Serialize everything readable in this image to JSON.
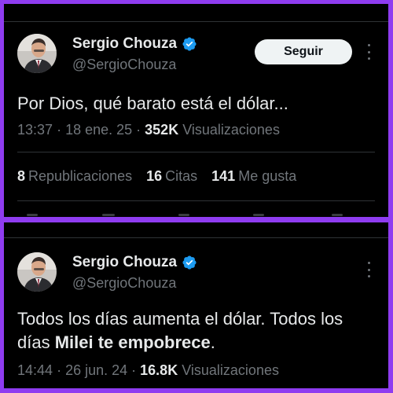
{
  "tweet1": {
    "display_name": "Sergio Chouza",
    "handle": "@SergioChouza",
    "follow_label": "Seguir",
    "text": "Por Dios, qué barato está el dólar...",
    "time": "13:37",
    "date": "18 ene. 25",
    "views_count": "352K",
    "views_label": "Visualizaciones",
    "stats": {
      "reposts_count": "8",
      "reposts_label": "Republicaciones",
      "quotes_count": "16",
      "quotes_label": "Citas",
      "likes_count": "141",
      "likes_label": "Me gusta"
    }
  },
  "tweet2": {
    "display_name": "Sergio Chouza",
    "handle": "@SergioChouza",
    "text_part1": "Todos los días aumenta el dólar. Todos los días ",
    "text_bold": "Milei te empobrece",
    "text_part2": ".",
    "time": "14:44",
    "date": "26 jun. 24",
    "views_count": "16.8K",
    "views_label": "Visualizaciones"
  },
  "colors": {
    "frame_border": "#8f3cf0",
    "background": "#000000",
    "verified_badge": "#1d9bf0",
    "primary_text": "#e7e9ea",
    "secondary_text": "#71767b"
  },
  "icons": {
    "verified": "verified-badge-icon",
    "more": "more-options-icon"
  }
}
